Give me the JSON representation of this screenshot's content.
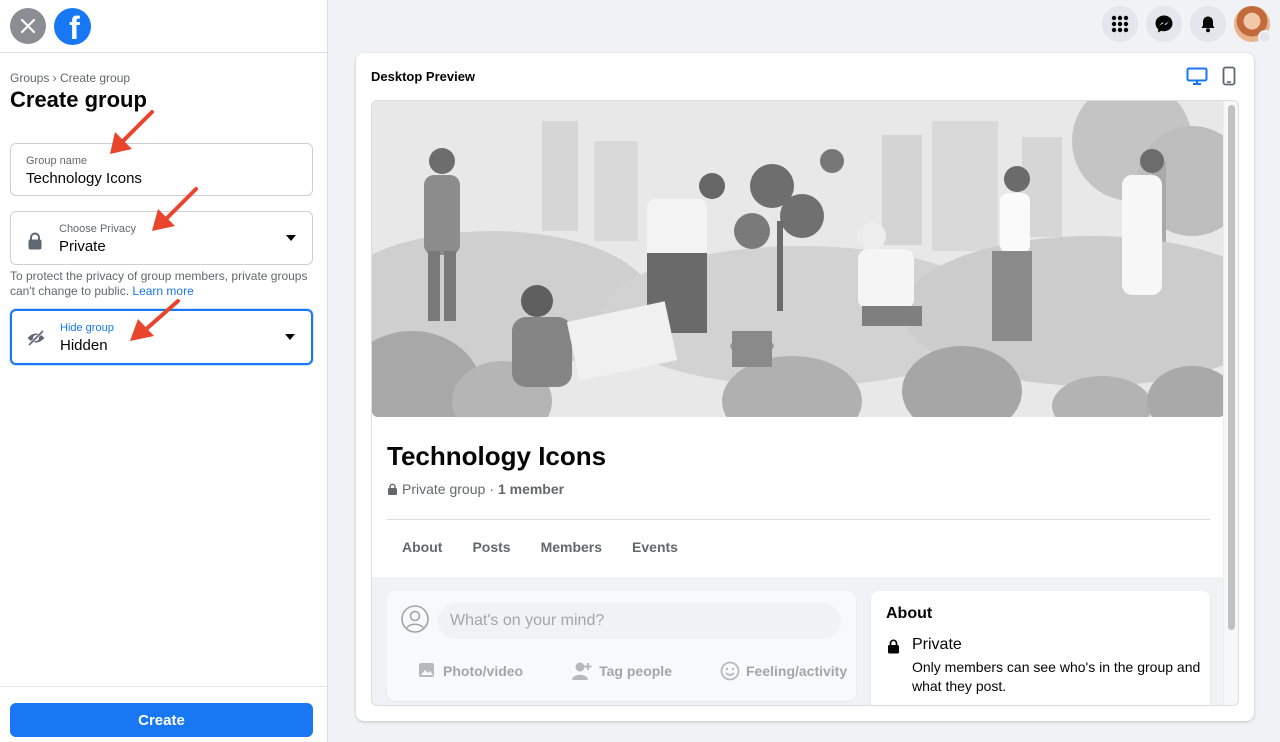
{
  "sidebar": {
    "breadcrumb": "Groups › Create group",
    "title": "Create group",
    "group_name": {
      "label": "Group name",
      "value": "Technology Icons"
    },
    "privacy": {
      "label": "Choose Privacy",
      "value": "Private"
    },
    "help_text": "To protect the privacy of group members, private groups can't change to public.",
    "learn_more": "Learn more",
    "hide": {
      "label": "Hide group",
      "value": "Hidden"
    },
    "create_label": "Create"
  },
  "preview": {
    "title": "Desktop Preview",
    "group_title": "Technology Icons",
    "privacy_text": "Private group",
    "separator": "·",
    "members_text": "1 member",
    "tabs": [
      "About",
      "Posts",
      "Members",
      "Events"
    ],
    "composer_placeholder": "What's on your mind?",
    "composer_actions": [
      "Photo/video",
      "Tag people",
      "Feeling/activity"
    ],
    "about_title": "About",
    "about_privacy": "Private",
    "about_desc": "Only members can see who's in the group and what they post."
  },
  "colors": {
    "accent": "#1877f2",
    "annotation_arrow": "#e8452c"
  },
  "icons": [
    "close-icon",
    "facebook-logo",
    "lock-icon",
    "eye-slash-icon",
    "menu-grid-icon",
    "messenger-icon",
    "bell-icon",
    "desktop-icon",
    "mobile-icon",
    "photo-icon",
    "tag-people-icon",
    "feeling-icon"
  ]
}
